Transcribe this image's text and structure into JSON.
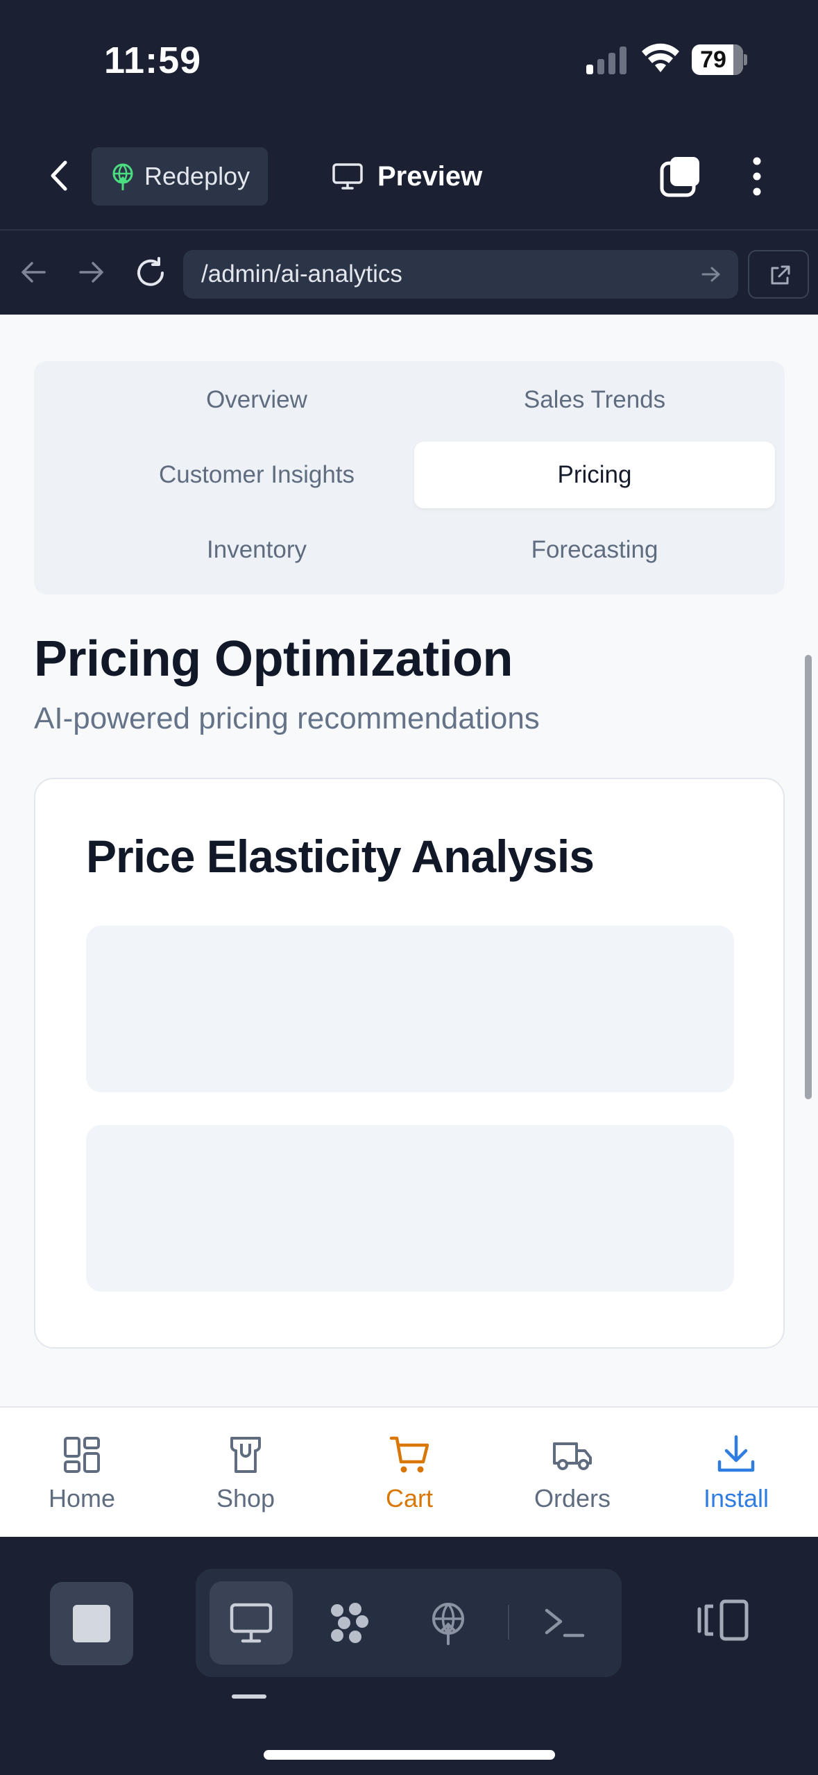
{
  "status": {
    "time": "11:59",
    "battery": "79"
  },
  "header": {
    "redeploy_label": "Redeploy",
    "preview_label": "Preview"
  },
  "browser": {
    "url": "/admin/ai-analytics"
  },
  "tabs": [
    {
      "label": "Overview",
      "active": false
    },
    {
      "label": "Sales Trends",
      "active": false
    },
    {
      "label": "Customer Insights",
      "active": false
    },
    {
      "label": "Pricing",
      "active": true
    },
    {
      "label": "Inventory",
      "active": false
    },
    {
      "label": "Forecasting",
      "active": false
    }
  ],
  "page": {
    "title": "Pricing Optimization",
    "subtitle": "AI-powered pricing recommendations",
    "card_title": "Price Elasticity Analysis"
  },
  "bottom_nav": [
    {
      "label": "Home",
      "icon": "grid-icon",
      "color": "#5f6c80"
    },
    {
      "label": "Shop",
      "icon": "shop-icon",
      "color": "#5f6c80"
    },
    {
      "label": "Cart",
      "icon": "cart-icon",
      "color": "#d97706"
    },
    {
      "label": "Orders",
      "icon": "truck-icon",
      "color": "#5f6c80"
    },
    {
      "label": "Install",
      "icon": "download-icon",
      "color": "#2f7de1"
    }
  ],
  "colors": {
    "accent_cart": "#d97706",
    "accent_install": "#2f7de1",
    "dark_bg": "#1b2133"
  }
}
